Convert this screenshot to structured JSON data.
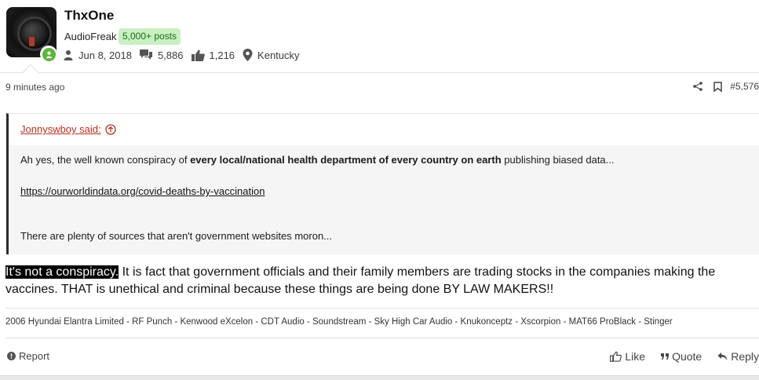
{
  "user": {
    "name": "ThxOne",
    "title": "AudioFreak",
    "posts_badge": "5,000+ posts",
    "joined": "Jun 8, 2018",
    "message_count": "5,886",
    "reaction_score": "1,216",
    "location": "Kentucky"
  },
  "post": {
    "time": "9 minutes ago",
    "number": "#5,576"
  },
  "quote": {
    "author": "Jonnyswboy said:",
    "text_before": "Ah yes, the well known conspiracy of ",
    "text_bold": "every local/national health department of every country on earth",
    "text_after": " publishing biased data...",
    "link": "https://ourworldindata.org/covid-deaths-by-vaccination",
    "last_line": "There are plenty of sources that aren't government websites moron..."
  },
  "message": {
    "highlight": "It's not a conspiracy.",
    "rest": " It is fact that government officials and their family members are trading stocks in the companies making the vaccines. THAT is unethical and criminal because these things are being done BY LAW MAKERS!!"
  },
  "signature": "2006 Hyundai Elantra Limited - RF Punch - Kenwood eXcelon - CDT Audio - Soundstream - Sky High Car Audio - Knukonceptz - Xscorpion - MAT66 ProBlack - Stinger",
  "footer": {
    "report": "Report",
    "like": "Like",
    "quote": "Quote",
    "reply": "Reply"
  },
  "colors": {
    "quote_author": "#b8321f",
    "posts_badge_bg": "#c9f0c2",
    "online": "#5cb53a"
  }
}
